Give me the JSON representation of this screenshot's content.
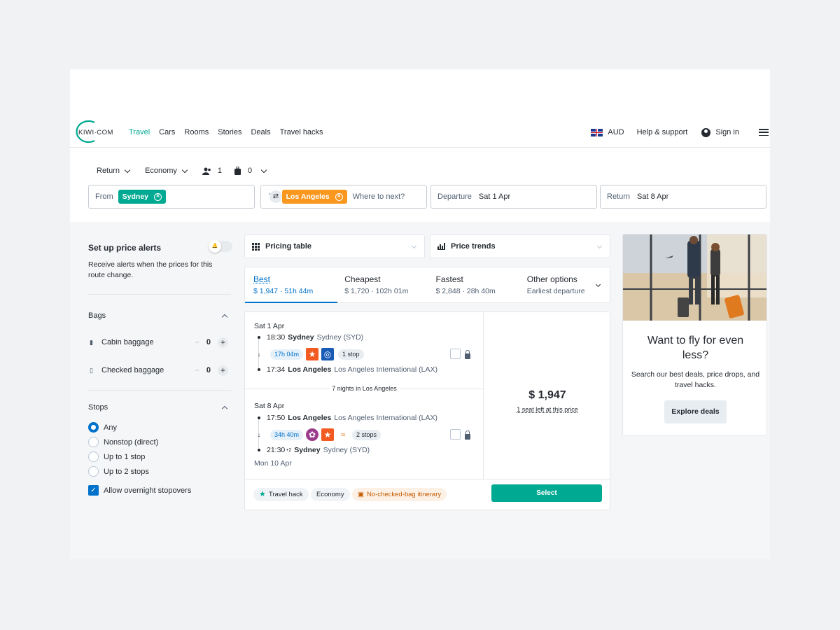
{
  "nav": {
    "logo_text": "KIWI·COM",
    "links": [
      "Travel",
      "Cars",
      "Rooms",
      "Stories",
      "Deals",
      "Travel hacks"
    ],
    "currency": "AUD",
    "help": "Help & support",
    "sign_in": "Sign in"
  },
  "search": {
    "trip_type": "Return",
    "cabin": "Economy",
    "passengers": "1",
    "bags": "0",
    "from_label": "From",
    "from_chip": "Sydney",
    "to_label": "To",
    "to_chip": "Los Angeles",
    "to_placeholder": "Where to next?",
    "departure_label": "Departure",
    "departure_value": "Sat 1 Apr",
    "return_label": "Return",
    "return_value": "Sat 8 Apr"
  },
  "sidebar": {
    "alerts_title": "Set up price alerts",
    "alerts_text": "Receive alerts when the prices for this route change.",
    "bags_title": "Bags",
    "cabin_label": "Cabin baggage",
    "cabin_value": "0",
    "checked_label": "Checked baggage",
    "checked_value": "0",
    "stops_title": "Stops",
    "stops_options": [
      "Any",
      "Nonstop (direct)",
      "Up to 1 stop",
      "Up to 2 stops"
    ],
    "overnight_label": "Allow overnight stopovers"
  },
  "main": {
    "pricing_table": "Pricing table",
    "price_trends": "Price trends",
    "tabs": [
      {
        "title": "Best",
        "sub": "$ 1,947 · 51h 44m"
      },
      {
        "title": "Cheapest",
        "sub": "$ 1,720 · 102h 01m"
      },
      {
        "title": "Fastest",
        "sub": "$ 2,848 · 28h 40m"
      },
      {
        "title": "Other options",
        "sub": "Earliest departure"
      }
    ]
  },
  "result": {
    "out_date": "Sat 1 Apr",
    "out_dep_time": "18:30",
    "out_dep_city": "Sydney",
    "out_dep_airport": "Sydney (SYD)",
    "out_duration": "17h 04m",
    "out_stops": "1 stop",
    "out_arr_time": "17:34",
    "out_arr_city": "Los Angeles",
    "out_arr_airport": "Los Angeles International (LAX)",
    "nights": "7 nights in Los Angeles",
    "ret_date": "Sat 8 Apr",
    "ret_dep_time": "17:50",
    "ret_dep_city": "Los Angeles",
    "ret_dep_airport": "Los Angeles International (LAX)",
    "ret_duration": "34h 40m",
    "ret_stops": "2 stops",
    "ret_arr_time": "21:30",
    "ret_arr_sup": "+2",
    "ret_arr_city": "Sydney",
    "ret_arr_airport": "Sydney (SYD)",
    "ret_arr_date": "Mon 10 Apr",
    "price": "$ 1,947",
    "seats": "1 seat left at this price",
    "select": "Select",
    "badges": [
      "Travel hack",
      "Economy",
      "No-checked-bag itinerary"
    ]
  },
  "promo": {
    "title": "Want to fly for even less?",
    "text": "Search our best deals, price drops, and travel hacks.",
    "button": "Explore deals"
  },
  "colors": {
    "brand": "#00a991",
    "blue": "#0172cb",
    "orange": "#f9971e"
  }
}
